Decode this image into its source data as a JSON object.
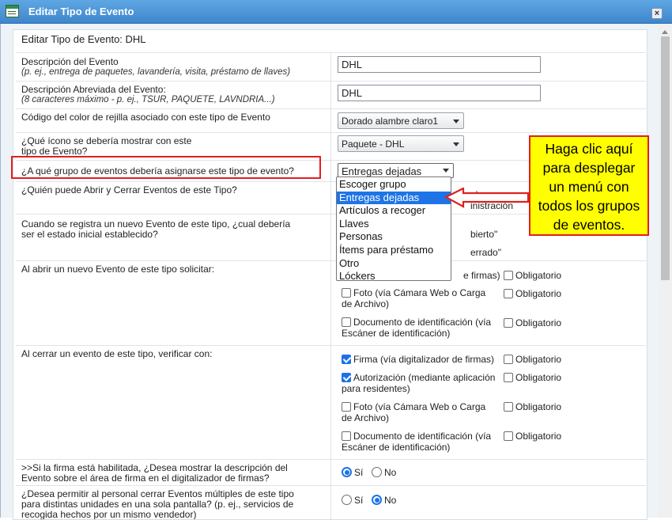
{
  "window": {
    "title": "Editar Tipo de Evento",
    "close_label": "×"
  },
  "form_title": "Editar Tipo de Evento: DHL",
  "fields": {
    "descripcion": {
      "label": "Descripción del Evento",
      "hint": "(p. ej., entrega de paquetes, lavandería, visita, préstamo de llaves)",
      "value": "DHL"
    },
    "abreviada": {
      "label": "Descripción Abreviada del Evento:",
      "hint": "(8 caracteres máximo - p. ej., TSUR, PAQUETE, LAVNDRIA...)",
      "value": "DHL"
    },
    "color": {
      "label": "Código del color de rejilla asociado con este tipo de Evento",
      "value": "Dorado alambre claro1"
    },
    "icono": {
      "label_line1": "¿Qué ícono se debería mostrar con este",
      "label_line2": "tipo de Evento?",
      "value": "Paquete - DHL"
    },
    "grupo": {
      "label": "¿A qué grupo de eventos debería asignarse este tipo de evento?",
      "value": "Entregas dejadas",
      "options": [
        "Escoger grupo",
        "Entregas dejadas",
        "Artículos a recoger",
        "Llaves",
        "Personas",
        "Ítems para préstamo",
        "Otro",
        "Lóckers"
      ],
      "selected_index": 1
    },
    "quien": {
      "label": "¿Quién puede Abrir y Cerrar Eventos de este Tipo?",
      "peek1": "olo personas con",
      "peek2": "inistración"
    },
    "estado": {
      "label_line1": "Cuando se registra un nuevo Evento de este tipo, ¿cual debería",
      "label_line2": "ser el estado inicial establecido?",
      "peek1": "bierto\"",
      "peek2": "errado\""
    },
    "abrir": {
      "label": "Al abrir un nuevo Evento de este tipo solicitar:",
      "items": [
        {
          "text1": "e firmas)",
          "text2": "",
          "checked": false,
          "obligatorio": "Obligatorio"
        },
        {
          "text1": "Foto (vía Cámara Web o Carga",
          "text2": "de Archivo)",
          "checked": false,
          "obligatorio": "Obligatorio"
        },
        {
          "text1": "Documento de identificación (vía",
          "text2": "Escáner de identificación)",
          "checked": false,
          "obligatorio": "Obligatorio"
        }
      ]
    },
    "cerrar": {
      "label": "Al cerrar un evento de este tipo, verificar con:",
      "items": [
        {
          "text1": "Firma (vía digitalizador de firmas)",
          "text2": "",
          "checked": true,
          "obligatorio": "Obligatorio"
        },
        {
          "text1": "Autorización (mediante aplicación",
          "text2": "para residentes)",
          "checked": true,
          "obligatorio": "Obligatorio"
        },
        {
          "text1": "Foto (vía Cámara Web o Carga",
          "text2": "de Archivo)",
          "checked": false,
          "obligatorio": "Obligatorio"
        },
        {
          "text1": "Documento de identificación (vía",
          "text2": "Escáner de identificación)",
          "checked": false,
          "obligatorio": "Obligatorio"
        }
      ]
    },
    "firma": {
      "label_line1": ">>Si la firma está habilitada, ¿Desea mostrar la descripción del",
      "label_line2": "Evento sobre el área de firma en el digitalizador de firmas?",
      "yes": "Sí",
      "no": "No",
      "selected": "yes"
    },
    "multiples": {
      "label_line1": "¿Desea permitir al personal cerrar Eventos múltiples de este tipo",
      "label_line2": "para distintas unidades en una sola pantalla? (p. ej., servicios de",
      "label_line3": "recogida hechos por un mismo vendedor)",
      "yes": "Sí",
      "no": "No",
      "selected": "no"
    }
  },
  "callout": {
    "lines": [
      "Haga clic aquí",
      "para desplegar",
      "un menú con",
      "todos los grupos",
      "de eventos."
    ],
    "highlight_color": "#ffff00",
    "border_color": "#e02020"
  }
}
